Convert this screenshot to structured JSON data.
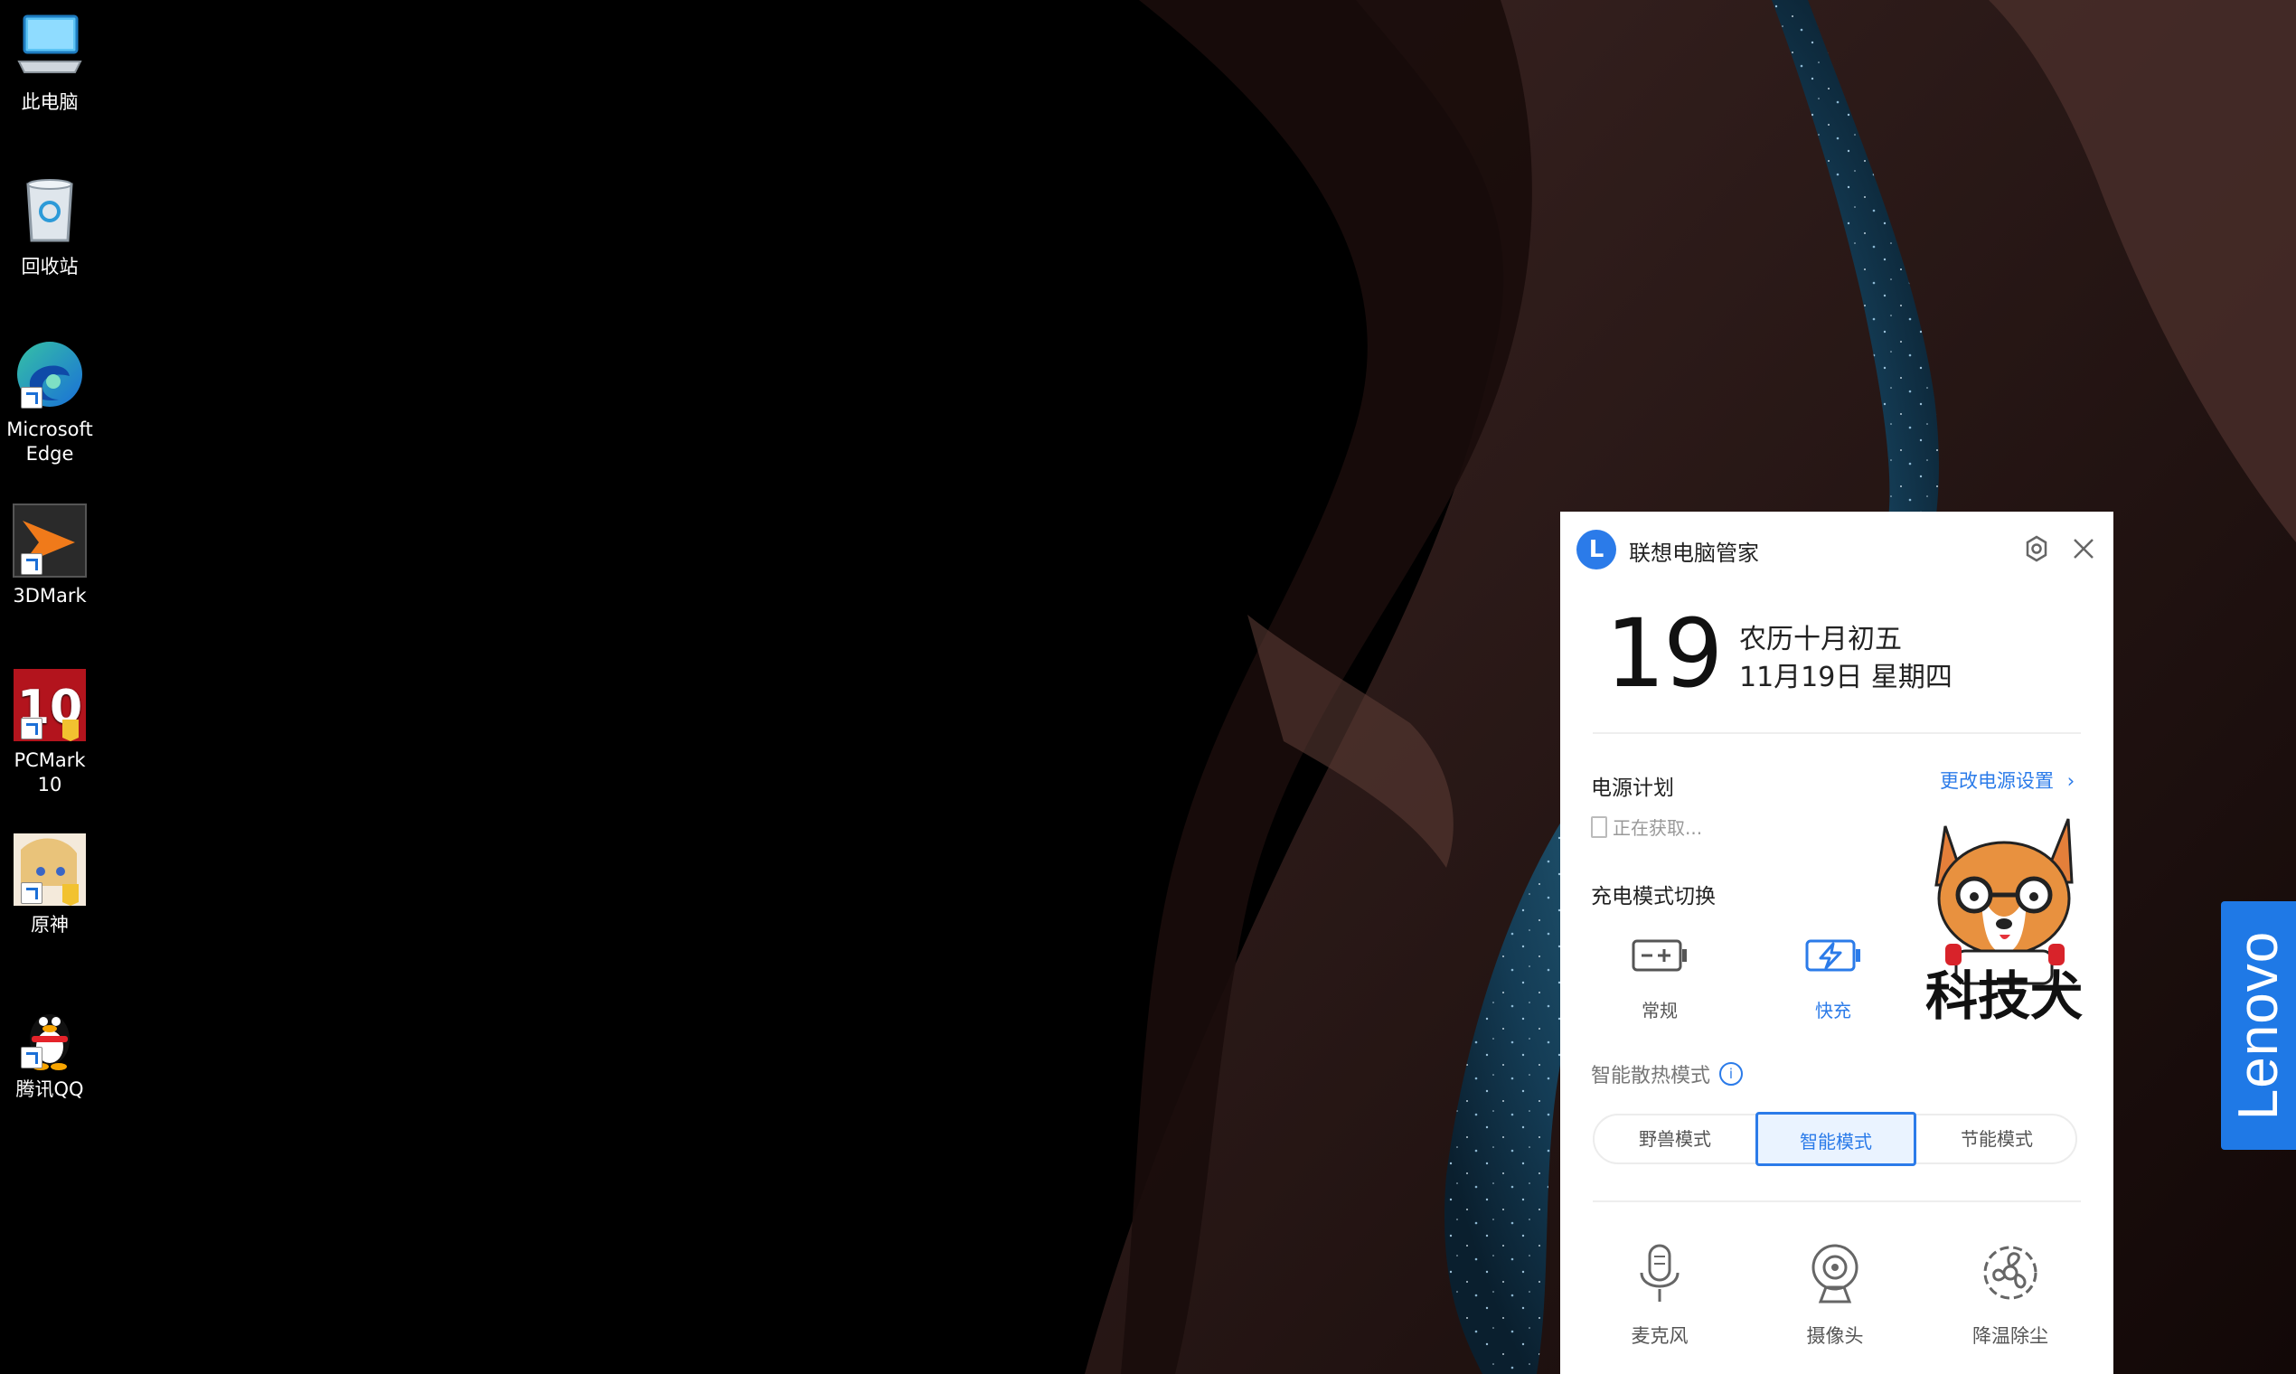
{
  "desktop": {
    "icons": [
      {
        "label": "此电脑"
      },
      {
        "label": "回收站"
      },
      {
        "label": "Microsoft Edge"
      },
      {
        "label": "3DMark"
      },
      {
        "label": "PCMark 10"
      },
      {
        "label": "原神"
      },
      {
        "label": "腾讯QQ"
      }
    ],
    "lenovo_tab": "Lenovo"
  },
  "panel": {
    "title": "联想电脑管家",
    "logo_letter": "L",
    "day": "19",
    "lunar_date": "农历十月初五",
    "solar_date": "11月19日 星期四",
    "power_plan": {
      "label": "电源计划",
      "link": "更改电源设置",
      "status": "正在获取..."
    },
    "charge": {
      "label": "充电模式切换",
      "options": [
        {
          "label": "常规",
          "selected": false
        },
        {
          "label": "快充",
          "selected": true
        }
      ]
    },
    "sticker_text": "科技犬",
    "cooling": {
      "label": "智能散热模式",
      "modes": [
        {
          "label": "野兽模式",
          "selected": false
        },
        {
          "label": "智能模式",
          "selected": true
        },
        {
          "label": "节能模式",
          "selected": false
        }
      ]
    },
    "tools": [
      {
        "label": "麦克风",
        "icon": "microphone-icon"
      },
      {
        "label": "摄像头",
        "icon": "camera-icon"
      },
      {
        "label": "降温除尘",
        "icon": "fan-icon"
      }
    ]
  },
  "colors": {
    "accent": "#2b7be9",
    "lenovo": "#1f79e6"
  }
}
